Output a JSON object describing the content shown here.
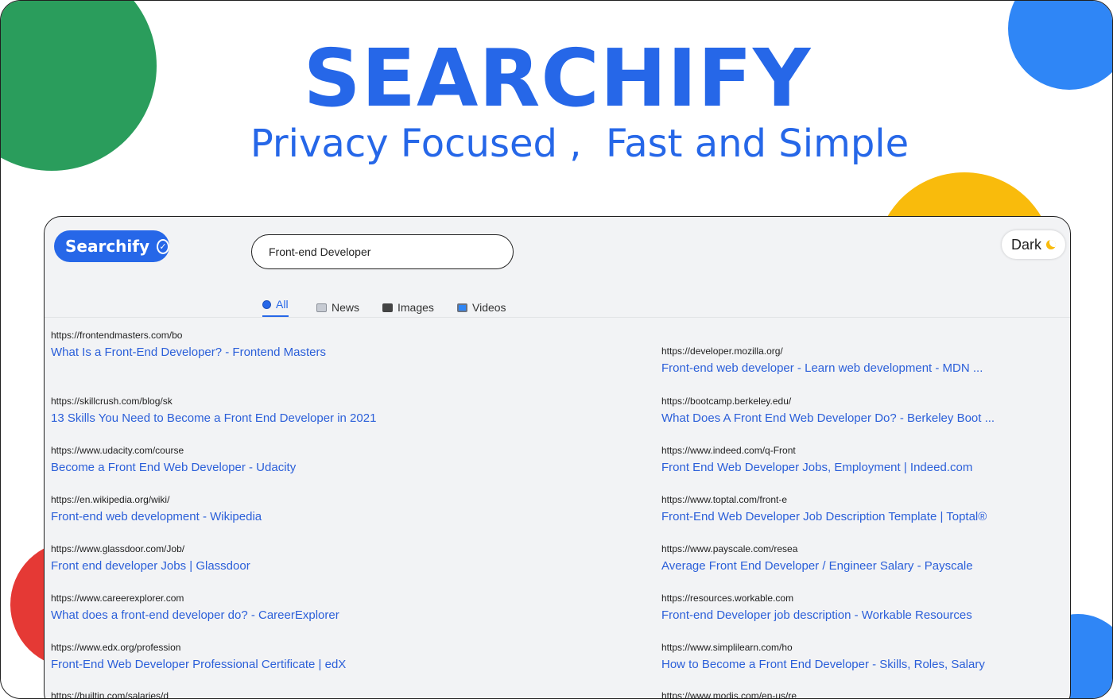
{
  "hero": {
    "title": "SEARCHIFY",
    "subtitle": "Privacy Focused ,  Fast and Simple"
  },
  "colors": {
    "brand_blue": "#2667e8",
    "link_blue": "#2b5fd9",
    "green": "#2a9d5c",
    "yellow": "#f9bb0c",
    "red": "#e53935",
    "light_blue": "#2f86f6"
  },
  "header": {
    "logo_label": "Searchify",
    "logo_icon": "check-circle-icon",
    "search_value": "Front-end Developer",
    "theme_toggle_label": "Dark",
    "theme_toggle_icon": "moon-icon"
  },
  "tabs": [
    {
      "label": "All",
      "icon": "search-icon",
      "active": true
    },
    {
      "label": "News",
      "icon": "newspaper-icon",
      "active": false
    },
    {
      "label": "Images",
      "icon": "camera-icon",
      "active": false
    },
    {
      "label": "Videos",
      "icon": "tv-icon",
      "active": false
    }
  ],
  "results_left": [
    {
      "url": "https://frontendmasters.com/bo",
      "title": "What Is a Front-End Developer? - Frontend Masters"
    },
    {
      "url": "https://skillcrush.com/blog/sk",
      "title": "13 Skills You Need to Become a Front End Developer in 2021"
    },
    {
      "url": "https://www.udacity.com/course",
      "title": "Become a Front End Web Developer - Udacity"
    },
    {
      "url": "https://en.wikipedia.org/wiki/",
      "title": "Front-end web development - Wikipedia"
    },
    {
      "url": "https://www.glassdoor.com/Job/",
      "title": "Front end developer Jobs | Glassdoor"
    },
    {
      "url": "https://www.careerexplorer.com",
      "title": "What does a front-end developer do? - CareerExplorer"
    },
    {
      "url": "https://www.edx.org/profession",
      "title": "Front-End Web Developer Professional Certificate | edX"
    },
    {
      "url": "https://builtin.com/salaries/d",
      "title": ""
    }
  ],
  "results_right": [
    {
      "url": "https://developer.mozilla.org/",
      "title": "Front-end web developer - Learn web development - MDN ..."
    },
    {
      "url": "https://bootcamp.berkeley.edu/",
      "title": "What Does A Front End Web Developer Do? - Berkeley Boot ..."
    },
    {
      "url": "https://www.indeed.com/q-Front",
      "title": "Front End Web Developer Jobs, Employment | Indeed.com"
    },
    {
      "url": "https://www.toptal.com/front-e",
      "title": "Front-End Web Developer Job Description Template | Toptal®"
    },
    {
      "url": "https://www.payscale.com/resea",
      "title": "Average Front End Developer / Engineer Salary - Payscale"
    },
    {
      "url": "https://resources.workable.com",
      "title": "Front-end Developer job description - Workable Resources"
    },
    {
      "url": "https://www.simplilearn.com/ho",
      "title": "How to Become a Front End Developer - Skills, Roles, Salary"
    },
    {
      "url": "https://www.modis.com/en-us/re",
      "title": ""
    }
  ]
}
